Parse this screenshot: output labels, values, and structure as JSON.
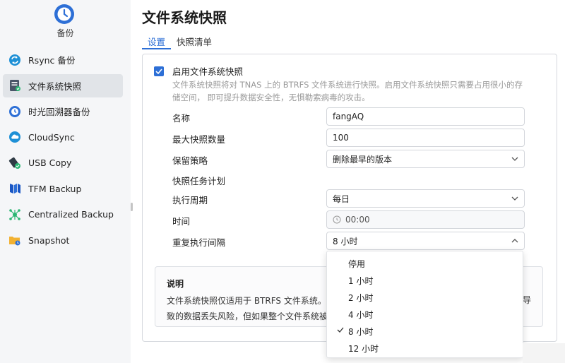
{
  "app": {
    "title": "备份"
  },
  "sidebar": {
    "items": [
      {
        "label": "Rsync 备份",
        "icon": "rsync-sync-icon",
        "active": false
      },
      {
        "label": "文件系统快照",
        "icon": "filesystem-snapshot-icon",
        "active": true
      },
      {
        "label": "时光回溯器备份",
        "icon": "time-machine-icon",
        "active": false
      },
      {
        "label": "CloudSync",
        "icon": "cloud-icon",
        "active": false
      },
      {
        "label": "USB Copy",
        "icon": "usb-copy-icon",
        "active": false
      },
      {
        "label": "TFM Backup",
        "icon": "tfm-backup-icon",
        "active": false
      },
      {
        "label": "Centralized Backup",
        "icon": "centralized-backup-icon",
        "active": false
      },
      {
        "label": "Snapshot",
        "icon": "snapshot-folder-icon",
        "active": false
      }
    ]
  },
  "main": {
    "title": "文件系统快照",
    "tabs": [
      {
        "label": "设置",
        "active": true
      },
      {
        "label": "快照清单",
        "active": false
      }
    ],
    "enable": {
      "label": "启用文件系统快照",
      "checked": true,
      "desc_line1": "文件系统快照将对 TNAS 上的 BTRFS 文件系统进行快照。启用文件系统快照只需要占用很小的存",
      "desc_line2": "储空间， 即可提升数据安全性，无惧勒索病毒的攻击。"
    },
    "form": {
      "name_label": "名称",
      "name_value": "fangAQ",
      "max_label": "最大快照数量",
      "max_value": "100",
      "policy_label": "保留策略",
      "policy_value": "删除最早的版本",
      "schedule_heading": "快照任务计划",
      "cycle_label": "执行周期",
      "cycle_value": "每日",
      "time_label": "时间",
      "time_value": "00:00",
      "interval_label": "重复执行间隔",
      "interval_value": "8 小时"
    },
    "note": {
      "title": "说明",
      "line1": "文件系统快照仅适用于 BTRFS 文件系统。",
      "line2": "致的数据丢失风险，但如果整个文件系统被",
      "tail": "导"
    }
  },
  "dropdown": {
    "options": [
      "停用",
      "1 小时",
      "2 小时",
      "4 小时",
      "8 小时",
      "12 小时"
    ],
    "selected": "8 小时"
  },
  "colors": {
    "accent": "#2d6fd6",
    "sidebar_bg": "#f5f6f8",
    "active_item": "#e1e4e8"
  }
}
